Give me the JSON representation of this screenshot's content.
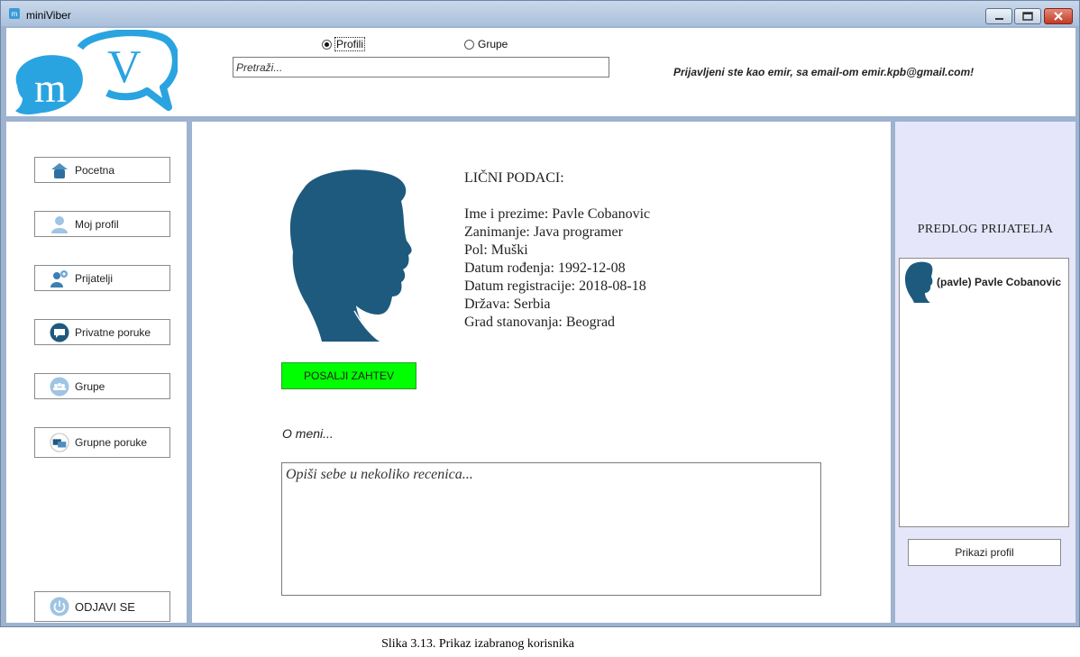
{
  "window": {
    "title": "miniViber"
  },
  "logo": {
    "letters_m": "m",
    "letters_v": "V"
  },
  "search_type": {
    "options": [
      "Profili",
      "Grupe"
    ],
    "selected": "Profili"
  },
  "search": {
    "placeholder": "Pretraži..."
  },
  "status": {
    "logged_in_text": "Prijavljeni ste kao emir, sa email-om emir.kpb@gmail.com!"
  },
  "sidebar": {
    "items": [
      {
        "label": "Pocetna",
        "icon": "home-icon"
      },
      {
        "label": "Moj profil",
        "icon": "user-icon"
      },
      {
        "label": "Prijatelji",
        "icon": "friends-icon"
      },
      {
        "label": "Privatne poruke",
        "icon": "chat-icon"
      },
      {
        "label": "Grupe",
        "icon": "group-icon"
      },
      {
        "label": "Grupne poruke",
        "icon": "group-chat-icon"
      }
    ],
    "logout_label": "ODJAVI SE"
  },
  "profile": {
    "section_title": "LIČNI PODACI:",
    "fields": [
      "Ime i prezime: Pavle Cobanovic",
      "Zanimanje: Java programer",
      "Pol: Muški",
      "Datum rođenja: 1992-12-08",
      "Datum registracije: 2018-08-18",
      "Država: Serbia",
      "Grad stanovanja: Beograd"
    ],
    "send_request_label": "POSALJI ZAHTEV",
    "about_label": "O meni...",
    "about_placeholder": "Opiši sebe u nekoliko recenica..."
  },
  "suggestions": {
    "title": "PREDLOG PRIJATELJA",
    "items": [
      "(pavle) Pavle Cobanovic"
    ],
    "show_profile_label": "Prikazi profil"
  },
  "caption": "Slika 3.13. Prikaz izabranog korisnika",
  "colors": {
    "accent_blue": "#1e5a7e",
    "logo_blue": "#2aa4e0",
    "send_green": "#00ff00",
    "side_panel": "#e6e6fa",
    "frame": "#9db3cf"
  }
}
